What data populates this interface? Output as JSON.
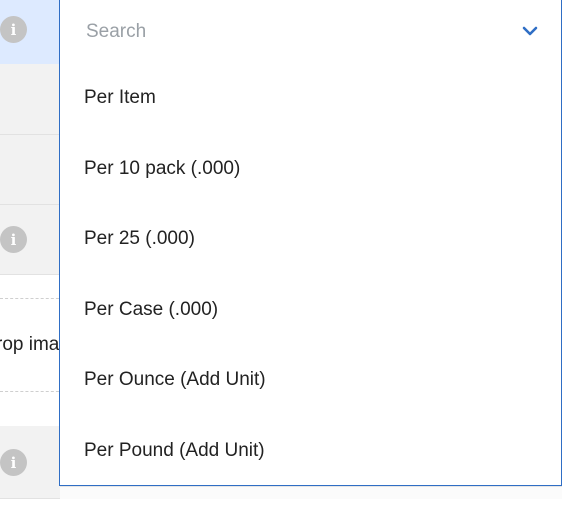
{
  "background_rows": {
    "drop_text": "rop ima"
  },
  "search": {
    "placeholder": "Search",
    "value": ""
  },
  "options": [
    "Per Item",
    "Per 10 pack (.000)",
    "Per 25 (.000)",
    "Per Case (.000)",
    "Per Ounce (Add Unit)",
    "Per Pound (Add Unit)"
  ],
  "icons": {
    "info": "i",
    "chevron": "chevron-down-icon"
  },
  "colors": {
    "accent": "#2f6ec5",
    "selected_row": "#ddeaff",
    "info_icon": "#c4c4c4"
  }
}
